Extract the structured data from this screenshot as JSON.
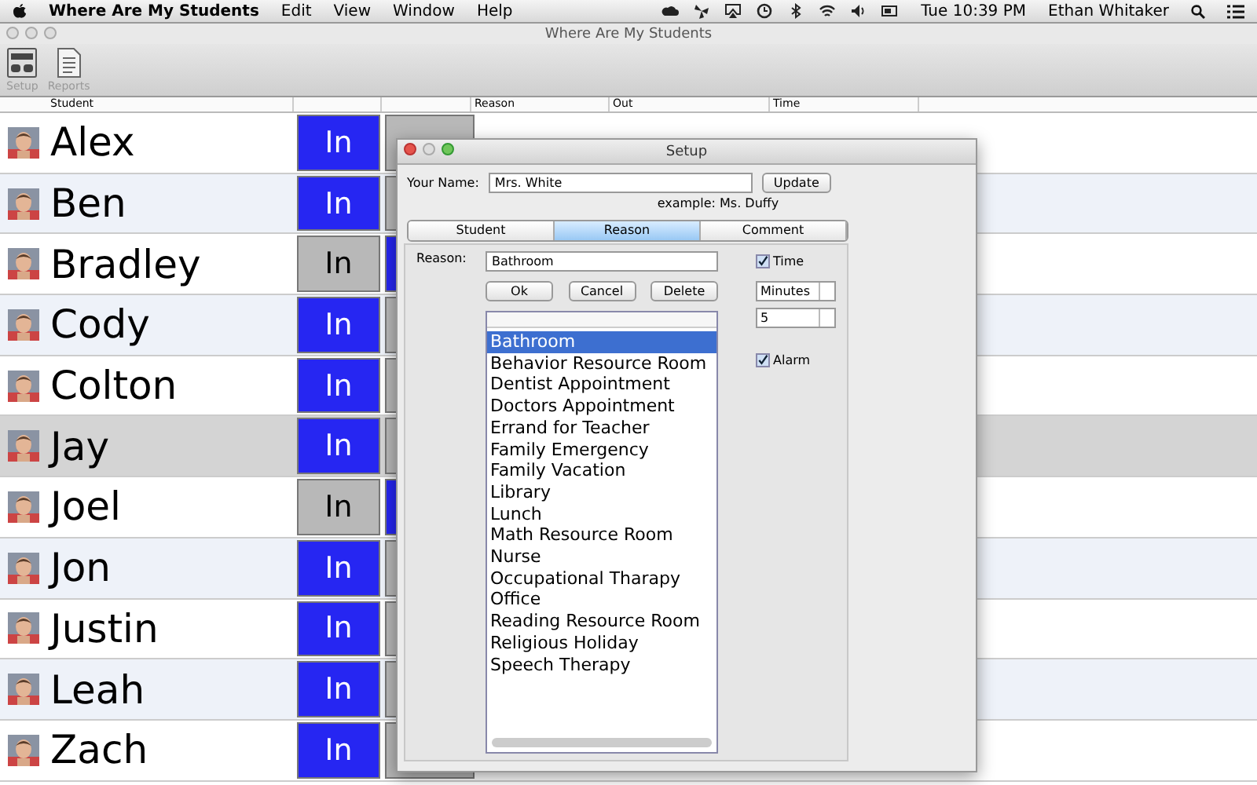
{
  "menu_bar": {
    "app": "Where Are My Students",
    "menus": [
      "Edit",
      "View",
      "Window",
      "Help"
    ],
    "clock": "Tue 10:39 PM",
    "user": "Ethan Whitaker"
  },
  "window": {
    "title": "Where Are My Students"
  },
  "toolbar": [
    {
      "kind": "setup",
      "label": "Setup"
    },
    {
      "kind": "reports",
      "label": "Reports"
    }
  ],
  "table": {
    "columns": [
      {
        "kind": "student",
        "label": "Student"
      },
      {
        "kind": "in"
      },
      {
        "kind": "out"
      },
      {
        "kind": "reason",
        "label": "Reason"
      },
      {
        "kind": "out_time",
        "label": "Out"
      },
      {
        "kind": "time",
        "label": "Time"
      }
    ],
    "rows": [
      {
        "name": "Alex",
        "in_label": "In",
        "in": true,
        "selected": false
      },
      {
        "name": "Ben",
        "in_label": "In",
        "in": true,
        "selected": false
      },
      {
        "name": "Bradley",
        "in_label": "In",
        "in": false,
        "selected": false
      },
      {
        "name": "Cody",
        "in_label": "In",
        "in": true,
        "selected": false
      },
      {
        "name": "Colton",
        "in_label": "In",
        "in": true,
        "selected": false
      },
      {
        "name": "Jay",
        "in_label": "In",
        "in": true,
        "selected": true
      },
      {
        "name": "Joel",
        "in_label": "In",
        "in": false,
        "selected": false
      },
      {
        "name": "Jon",
        "in_label": "In",
        "in": true,
        "selected": false
      },
      {
        "name": "Justin",
        "in_label": "In",
        "in": true,
        "selected": false
      },
      {
        "name": "Leah",
        "in_label": "In",
        "in": true,
        "selected": false
      },
      {
        "name": "Zach",
        "in_label": "In",
        "in": true,
        "selected": false
      }
    ]
  },
  "dialog": {
    "title": "Setup",
    "name_label": "Your Name:",
    "name_value": "Mrs. White",
    "update_button": "Update",
    "example": "example: Ms. Duffy",
    "tabs": [
      {
        "label": "Student",
        "selected": false
      },
      {
        "label": "Reason",
        "selected": true
      },
      {
        "label": "Comment",
        "selected": false
      }
    ],
    "reason_label": "Reason:",
    "reason_value": "Bathroom",
    "buttons": [
      "Ok",
      "Cancel",
      "Delete"
    ],
    "reasons": [
      {
        "label": "Bathroom",
        "selected": true
      },
      {
        "label": "Behavior Resource Room",
        "selected": false
      },
      {
        "label": "Dentist Appointment",
        "selected": false
      },
      {
        "label": "Doctors Appointment",
        "selected": false
      },
      {
        "label": "Errand for Teacher",
        "selected": false
      },
      {
        "label": "Family Emergency",
        "selected": false
      },
      {
        "label": "Family Vacation",
        "selected": false
      },
      {
        "label": "Library",
        "selected": false
      },
      {
        "label": "Lunch",
        "selected": false
      },
      {
        "label": "Math Resource Room",
        "selected": false
      },
      {
        "label": "Nurse",
        "selected": false
      },
      {
        "label": "Occupational Tharapy",
        "selected": false
      },
      {
        "label": "Office",
        "selected": false
      },
      {
        "label": "Reading Resource Room",
        "selected": false
      },
      {
        "label": "Religious Holiday",
        "selected": false
      },
      {
        "label": "Speech Therapy",
        "selected": false
      }
    ],
    "time": {
      "label": "Time",
      "checked": true
    },
    "unit": "Minutes",
    "amount": "5",
    "alarm": {
      "label": "Alarm",
      "checked": true
    }
  }
}
